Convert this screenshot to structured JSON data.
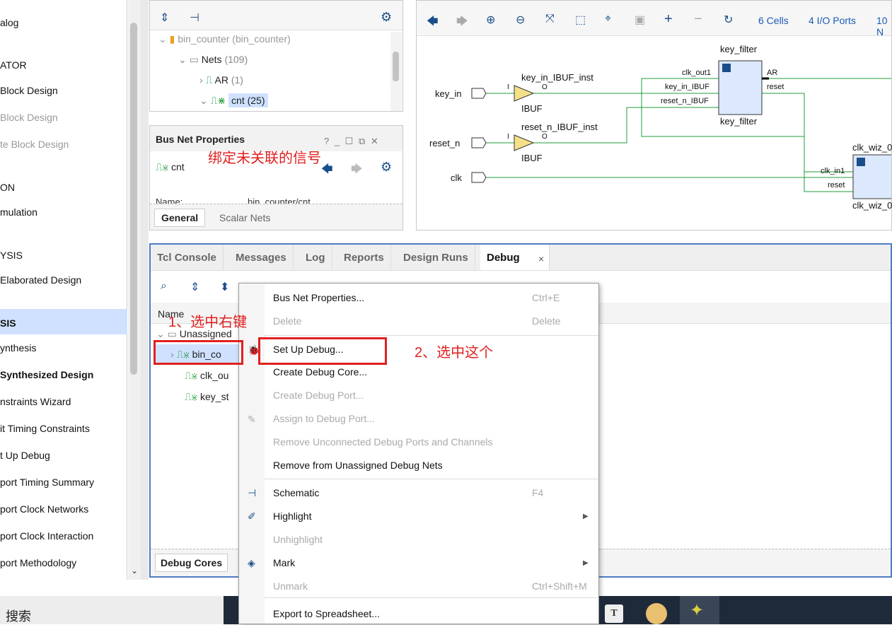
{
  "flow_navigator": {
    "items": [
      {
        "label": "alog",
        "style": "normal"
      },
      {
        "label": "ATOR",
        "style": "normal"
      },
      {
        "label": " Block Design",
        "style": "normal"
      },
      {
        "label": "Block Design",
        "style": "dim"
      },
      {
        "label": "te Block Design",
        "style": "dim"
      },
      {
        "label": "ON",
        "style": "normal"
      },
      {
        "label": "mulation",
        "style": "normal"
      },
      {
        "label": "YSIS",
        "style": "normal"
      },
      {
        "label": "Elaborated Design",
        "style": "normal"
      },
      {
        "label": "SIS",
        "style": "bold"
      },
      {
        "label": "ynthesis",
        "style": "normal"
      },
      {
        "label": " Synthesized Design",
        "style": "bold"
      },
      {
        "label": "nstraints Wizard",
        "style": "normal"
      },
      {
        "label": "it Timing Constraints",
        "style": "normal"
      },
      {
        "label": "t Up Debug",
        "style": "normal"
      },
      {
        "label": "port Timing Summary",
        "style": "normal"
      },
      {
        "label": "port Clock Networks",
        "style": "normal"
      },
      {
        "label": "port Clock Interaction",
        "style": "normal"
      },
      {
        "label": "port Methodology",
        "style": "normal"
      }
    ]
  },
  "nets_panel": {
    "root_label": "bin_counter",
    "root_suffix": "(bin_counter)",
    "nets_label": "Nets",
    "nets_count": "(109)",
    "ar_label": "AR",
    "ar_count": "(1)",
    "cnt_label": "cnt (25)"
  },
  "bus_net_props": {
    "title": "Bus Net Properties",
    "title_controls": "? _ ☐ ⧉ ✕",
    "net_name": "cnt",
    "name_field": "Name:",
    "name_value": "bin_counter/cnt",
    "tabs": [
      "General",
      "Scalar Nets"
    ]
  },
  "schematic": {
    "cells_link": "6 Cells",
    "io_link": "4 I/O Ports",
    "nets_link": "10 N",
    "ports": [
      "key_in",
      "reset_n",
      "clk"
    ],
    "ibuf_inst_1": "key_in_IBUF_inst",
    "ibuf_inst_2": "reset_n_IBUF_inst",
    "ibuf_label": "IBUF",
    "pin_i": "I",
    "pin_o": "O",
    "key_filter": "key_filter",
    "kf_in_pins": [
      "clk_out1",
      "key_in_IBUF",
      "reset_n_IBUF"
    ],
    "kf_out_pins": [
      "AR",
      "reset"
    ],
    "clk_wiz": "clk_wiz_0",
    "cw_pins": [
      "clk_in1",
      "reset"
    ]
  },
  "debug_panel": {
    "tabs": [
      "Tcl Console",
      "Messages",
      "Log",
      "Reports",
      "Design Runs",
      "Debug"
    ],
    "close": "×",
    "col_name": "Name",
    "unassigned": "Unassigned",
    "rows": [
      "bin_co",
      "clk_ou",
      "key_st"
    ],
    "bottom_tab": "Debug Cores"
  },
  "context_menu": {
    "items": [
      {
        "label": "Bus Net Properties...",
        "shortcut": "Ctrl+E",
        "disabled": false
      },
      {
        "label": "Delete",
        "shortcut": "Delete",
        "disabled": true
      },
      {
        "label": "Set Up Debug...",
        "shortcut": "",
        "disabled": false
      },
      {
        "label": "Create Debug Core...",
        "shortcut": "",
        "disabled": false
      },
      {
        "label": "Create Debug Port...",
        "shortcut": "",
        "disabled": true
      },
      {
        "label": "Assign to Debug Port...",
        "shortcut": "",
        "disabled": true
      },
      {
        "label": "Remove Unconnected Debug Ports and Channels",
        "shortcut": "",
        "disabled": true
      },
      {
        "label": "Remove from Unassigned Debug Nets",
        "shortcut": "",
        "disabled": false
      },
      {
        "label": "Schematic",
        "shortcut": "F4",
        "disabled": false
      },
      {
        "label": "Highlight",
        "shortcut": "",
        "disabled": false
      },
      {
        "label": "Unhighlight",
        "shortcut": "",
        "disabled": true
      },
      {
        "label": "Mark",
        "shortcut": "",
        "disabled": false
      },
      {
        "label": "Unmark",
        "shortcut": "Ctrl+Shift+M",
        "disabled": true
      },
      {
        "label": "Export to Spreadsheet...",
        "shortcut": "",
        "disabled": false
      }
    ]
  },
  "annotations": {
    "a1": "绑定未关联的信号",
    "a2": "1、选中右键",
    "a3": "2、选中这个"
  },
  "taskbar": {
    "search": "搜索",
    "t_icon": "T"
  },
  "colors": {
    "accent": "#1a4e8a",
    "annotation": "#e0201f",
    "wire": "#1f9e3a",
    "selected": "#cfe1ff"
  }
}
